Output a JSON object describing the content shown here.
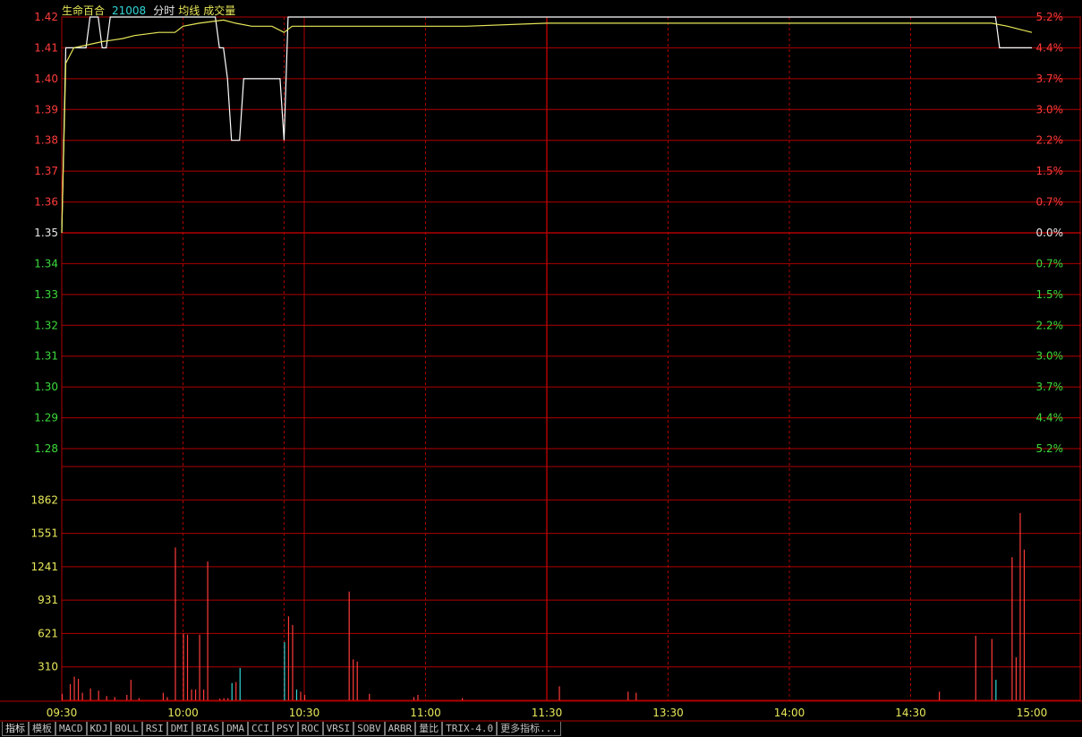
{
  "header": {
    "stock_name": "生命百合",
    "stock_code": "21008",
    "tab_intraday": "分时",
    "tab_avg": "均线",
    "tab_volume": "成交量"
  },
  "colors": {
    "grid": "#b00000",
    "up": "#ff3b3b",
    "down": "#3cdc3c",
    "flat": "#e8e8e8",
    "price_line": "#ffffff",
    "avg_line": "#e8e85a",
    "vol_axis": "#e8e85a",
    "vol_up": "#ff3b3b",
    "vol_down": "#33d6d6",
    "time_label": "#e8e85a"
  },
  "chart_data": {
    "type": "line",
    "price_axis": {
      "ticks": [
        "1.42",
        "1.41",
        "1.40",
        "1.39",
        "1.38",
        "1.37",
        "1.36",
        "1.35",
        "1.34",
        "1.33",
        "1.32",
        "1.31",
        "1.30",
        "1.29",
        "1.28"
      ],
      "ylim": [
        1.28,
        1.42
      ],
      "prev_close": 1.35
    },
    "pct_axis": {
      "ticks": [
        "5.2%",
        "4.4%",
        "3.7%",
        "3.0%",
        "2.2%",
        "1.5%",
        "0.7%",
        "0.0%",
        "0.7%",
        "1.5%",
        "2.2%",
        "3.0%",
        "3.7%",
        "4.4%",
        "5.2%"
      ]
    },
    "volume_axis": {
      "ticks": [
        "1862",
        "1551",
        "1241",
        "931",
        "621",
        "310"
      ],
      "ylim": [
        0,
        2172
      ]
    },
    "time_axis": {
      "ticks": [
        "09:30",
        "10:00",
        "10:30",
        "11:00",
        "11:30",
        "13:30",
        "14:00",
        "14:30",
        "15:00"
      ],
      "minutes": [
        0,
        30,
        60,
        90,
        120,
        150,
        180,
        210,
        240
      ]
    },
    "series": [
      {
        "key": "price",
        "points": [
          [
            0,
            1.35
          ],
          [
            1,
            1.41
          ],
          [
            6,
            1.41
          ],
          [
            7,
            1.42
          ],
          [
            9,
            1.42
          ],
          [
            10,
            1.41
          ],
          [
            11,
            1.41
          ],
          [
            12,
            1.42
          ],
          [
            38,
            1.42
          ],
          [
            39,
            1.41
          ],
          [
            40,
            1.41
          ],
          [
            41,
            1.4
          ],
          [
            42,
            1.38
          ],
          [
            44,
            1.38
          ],
          [
            45,
            1.4
          ],
          [
            54,
            1.4
          ],
          [
            55,
            1.38
          ],
          [
            56,
            1.42
          ],
          [
            231,
            1.42
          ],
          [
            232,
            1.41
          ],
          [
            240,
            1.41
          ]
        ]
      },
      {
        "key": "avg",
        "points": [
          [
            0,
            1.35
          ],
          [
            1,
            1.405
          ],
          [
            3,
            1.41
          ],
          [
            10,
            1.412
          ],
          [
            15,
            1.413
          ],
          [
            18,
            1.414
          ],
          [
            24,
            1.415
          ],
          [
            28,
            1.415
          ],
          [
            30,
            1.417
          ],
          [
            34,
            1.418
          ],
          [
            40,
            1.419
          ],
          [
            43,
            1.418
          ],
          [
            47,
            1.417
          ],
          [
            52,
            1.417
          ],
          [
            55,
            1.415
          ],
          [
            57,
            1.417
          ],
          [
            65,
            1.417
          ],
          [
            80,
            1.417
          ],
          [
            100,
            1.417
          ],
          [
            120,
            1.418
          ],
          [
            150,
            1.418
          ],
          [
            200,
            1.418
          ],
          [
            230,
            1.418
          ],
          [
            234,
            1.417
          ],
          [
            237,
            1.416
          ],
          [
            240,
            1.415
          ]
        ]
      }
    ],
    "volume": [
      [
        0,
        60,
        "up"
      ],
      [
        2,
        150,
        "up"
      ],
      [
        3,
        220,
        "up"
      ],
      [
        4,
        200,
        "up"
      ],
      [
        5,
        70,
        "up"
      ],
      [
        7,
        110,
        "up"
      ],
      [
        9,
        90,
        "up"
      ],
      [
        11,
        40,
        "up"
      ],
      [
        13,
        30,
        "up"
      ],
      [
        16,
        50,
        "up"
      ],
      [
        17,
        190,
        "up"
      ],
      [
        19,
        20,
        "up"
      ],
      [
        25,
        70,
        "up"
      ],
      [
        26,
        30,
        "up"
      ],
      [
        28,
        1420,
        "up"
      ],
      [
        30,
        620,
        "up"
      ],
      [
        31,
        610,
        "up"
      ],
      [
        32,
        100,
        "up"
      ],
      [
        33,
        100,
        "up"
      ],
      [
        34,
        610,
        "up"
      ],
      [
        35,
        100,
        "up"
      ],
      [
        36,
        1290,
        "up"
      ],
      [
        39,
        15,
        "up"
      ],
      [
        40,
        20,
        "up"
      ],
      [
        41,
        20,
        "up"
      ],
      [
        42,
        160,
        "down"
      ],
      [
        43,
        170,
        "up"
      ],
      [
        44,
        300,
        "down"
      ],
      [
        55,
        540,
        "down"
      ],
      [
        56,
        780,
        "up"
      ],
      [
        57,
        700,
        "up"
      ],
      [
        58,
        100,
        "down"
      ],
      [
        59,
        80,
        "up"
      ],
      [
        60,
        50,
        "up"
      ],
      [
        71,
        1010,
        "up"
      ],
      [
        72,
        380,
        "up"
      ],
      [
        73,
        360,
        "up"
      ],
      [
        76,
        60,
        "up"
      ],
      [
        87,
        30,
        "up"
      ],
      [
        88,
        50,
        "up"
      ],
      [
        99,
        20,
        "up"
      ],
      [
        123,
        130,
        "up"
      ],
      [
        140,
        80,
        "up"
      ],
      [
        142,
        70,
        "up"
      ],
      [
        217,
        80,
        "up"
      ],
      [
        226,
        600,
        "up"
      ],
      [
        230,
        570,
        "up"
      ],
      [
        231,
        190,
        "down"
      ],
      [
        235,
        1330,
        "up"
      ],
      [
        236,
        400,
        "up"
      ],
      [
        237,
        1740,
        "up"
      ],
      [
        238,
        1400,
        "up"
      ]
    ]
  },
  "toolbar": {
    "tabs": [
      "指标",
      "模板",
      "MACD",
      "KDJ",
      "BOLL",
      "RSI",
      "DMI",
      "BIAS",
      "DMA",
      "CCI",
      "PSY",
      "ROC",
      "VRSI",
      "SOBV",
      "ARBR",
      "量比",
      "TRIX-4.0",
      "更多指标..."
    ]
  }
}
